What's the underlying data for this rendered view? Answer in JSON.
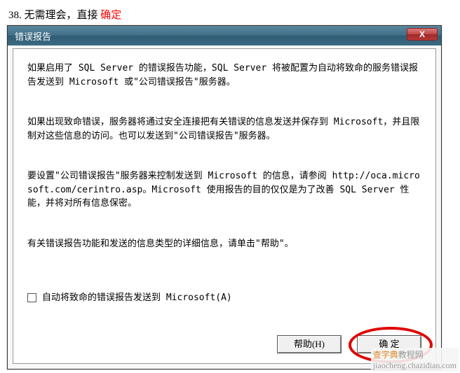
{
  "instruction": {
    "number": "38.",
    "text": "无需理会，直接",
    "highlight": "确定"
  },
  "window": {
    "title": "错误报告",
    "close_symbol": "X",
    "paragraphs": {
      "p1": "如果启用了 SQL Server 的错误报告功能，SQL Server 将被配置为自动将致命的服务错误报告发送到 Microsoft 或\"公司错误报告\"服务器。",
      "p2": "如果出现致命错误，服务器将通过安全连接把有关错误的信息发送并保存到 Microsoft，并且限制对这些信息的访问。也可以发送到\"公司错误报告\"服务器。",
      "p3": "要设置\"公司错误报告\"服务器来控制发送到 Microsoft 的信息，请参阅 http://oca.microsoft.com/cerintro.asp。Microsoft 使用报告的目的仅仅是为了改善 SQL Server 性能，并将对所有信息保密。",
      "p4": "有关错误报告功能和发送的信息类型的详细信息，请单击\"帮助\"。"
    },
    "checkbox": {
      "label": "自动将致命的错误报告发送到 Microsoft(A)"
    },
    "buttons": {
      "help": "帮助(H)",
      "ok": "确 定"
    }
  },
  "watermark": {
    "brand": "查字典",
    "suffix": "教程网",
    "url": "jiaocheng.chazidian.com"
  }
}
